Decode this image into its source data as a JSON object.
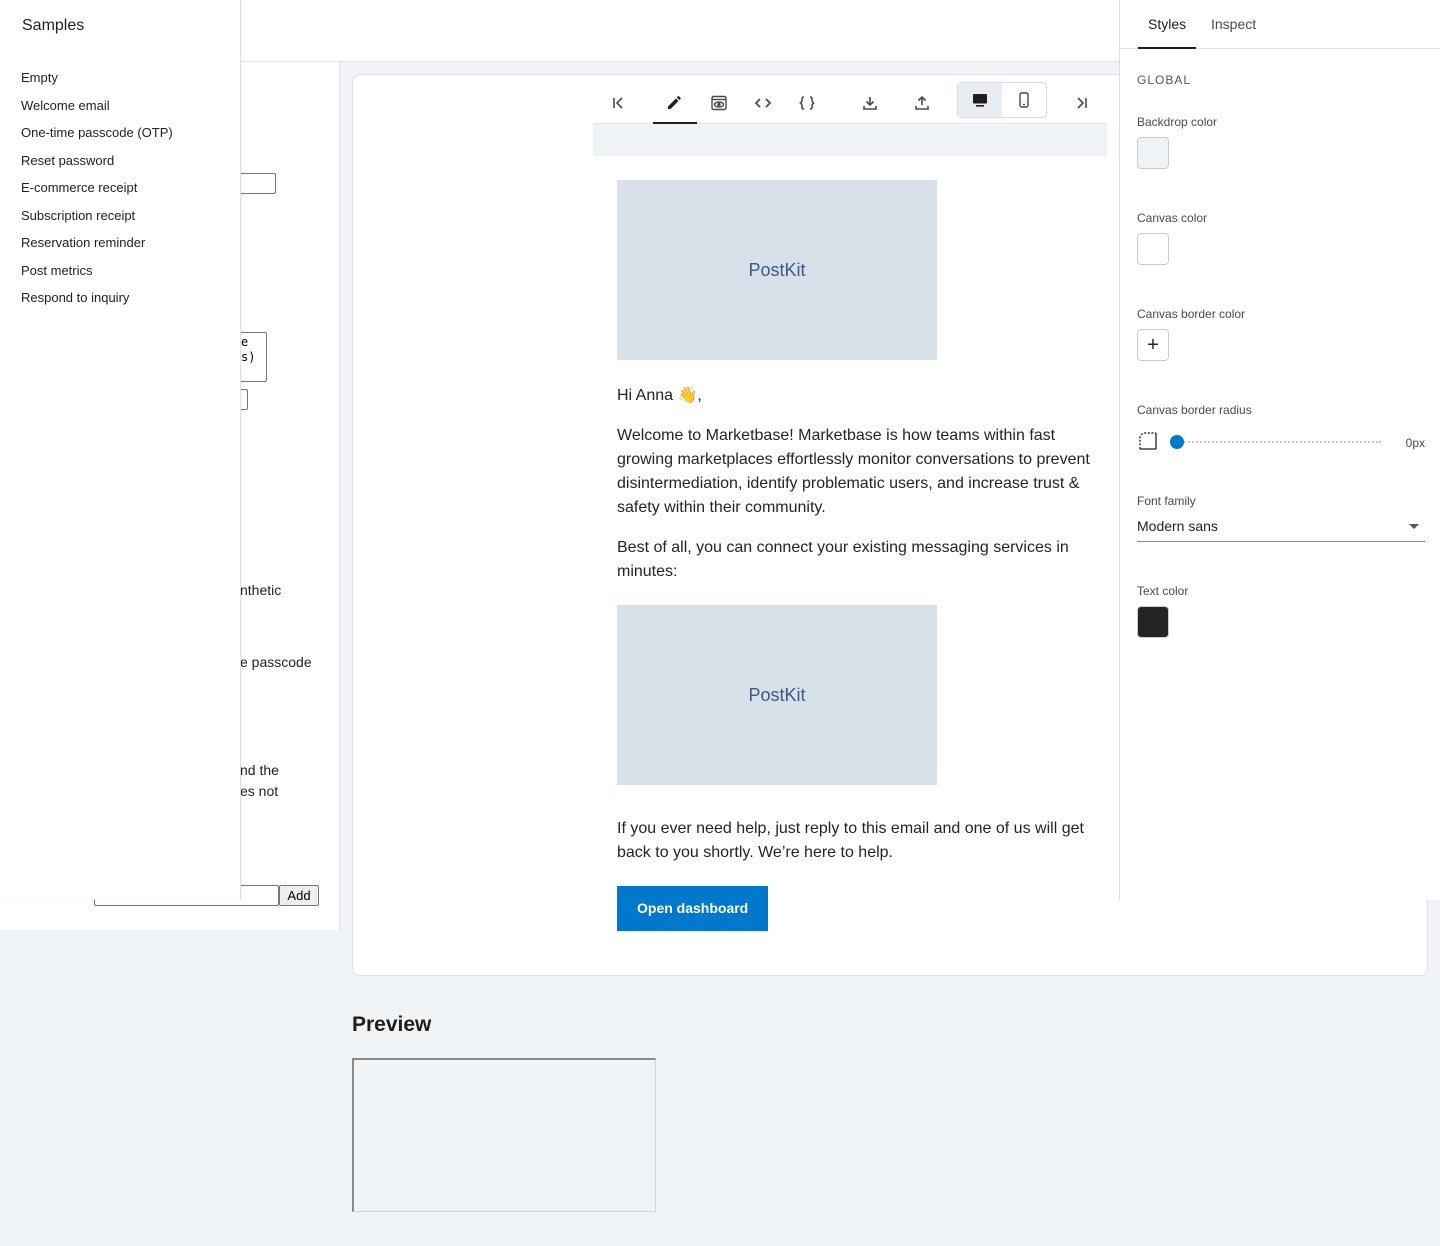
{
  "background_form": {
    "textarea_lines": [
      "e",
      "s)"
    ],
    "fragments": [
      "nthetic",
      "e passcode",
      "nd the",
      "es not"
    ],
    "add_label": "Add"
  },
  "samples": {
    "title": "Samples",
    "items": [
      {
        "label": "Empty"
      },
      {
        "label": "Welcome email"
      },
      {
        "label": "One-time passcode (OTP)"
      },
      {
        "label": "Reset password"
      },
      {
        "label": "E-commerce receipt"
      },
      {
        "label": "Subscription receipt"
      },
      {
        "label": "Reservation reminder"
      },
      {
        "label": "Post metrics"
      },
      {
        "label": "Respond to inquiry"
      }
    ]
  },
  "toolbar": {
    "buttons": [
      {
        "icon": "first-page-icon"
      },
      {
        "icon": "pencil-icon",
        "active": true
      },
      {
        "icon": "preview-eye-icon"
      },
      {
        "icon": "code-brackets-icon"
      },
      {
        "icon": "json-braces-icon"
      },
      {
        "icon": "download-icon"
      },
      {
        "icon": "upload-icon"
      },
      {
        "icon": "last-page-icon"
      }
    ],
    "devices": [
      {
        "icon": "desktop-icon",
        "selected": true
      },
      {
        "icon": "mobile-icon",
        "selected": false
      }
    ]
  },
  "email": {
    "logo_text": "PostKit",
    "greeting": "Hi Anna 👋,",
    "paragraph1": "Welcome to Marketbase! Marketbase is how teams within fast growing marketplaces effortlessly monitor conversations to prevent disintermediation, identify problematic users, and increase trust & safety within their community.",
    "paragraph2": "Best of all, you can connect your existing messaging services in minutes:",
    "image2_text": "PostKit",
    "paragraph3": "If you ever need help, just reply to this email and one of us will get back to you shortly. We’re here to help.",
    "cta_label": "Open dashboard"
  },
  "preview": {
    "title": "Preview"
  },
  "panel": {
    "tabs": {
      "styles": "Styles",
      "inspect": "Inspect"
    },
    "section": "GLOBAL",
    "backdrop_color": {
      "label": "Backdrop color",
      "value": "#F0F3F6"
    },
    "canvas_color": {
      "label": "Canvas color",
      "value": "#FFFFFF"
    },
    "canvas_border_color": {
      "label": "Canvas border color"
    },
    "canvas_border_radius": {
      "label": "Canvas border radius",
      "value": "0px",
      "level": 0
    },
    "font_family": {
      "label": "Font family",
      "value": "Modern sans"
    },
    "text_color": {
      "label": "Text color",
      "value": "#242424"
    }
  },
  "colors": {
    "accent": "#0079CC",
    "placeholder_bg": "#D8E0EA",
    "placeholder_text": "#3C5A82"
  }
}
